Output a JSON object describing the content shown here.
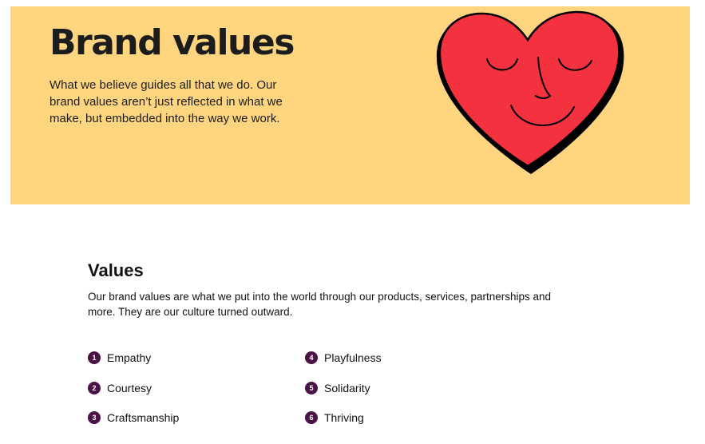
{
  "hero": {
    "title": "Brand values",
    "description": "What we believe guides all that we do. Our brand values aren’t just reflected in what we make, but embedded into the way we work.",
    "background_color": "#FFD580",
    "illustration": "smiling-heart-illustration",
    "heart_color": "#F4323F"
  },
  "values_section": {
    "title": "Values",
    "description": "Our brand values are what we put into the world through our products, services, partnerships and more. They are our culture turned outward.",
    "badge_color": "#4A1245",
    "items": [
      {
        "number": "1",
        "label": "Empathy"
      },
      {
        "number": "2",
        "label": "Courtesy"
      },
      {
        "number": "3",
        "label": "Craftsmanship"
      },
      {
        "number": "4",
        "label": "Playfulness"
      },
      {
        "number": "5",
        "label": "Solidarity"
      },
      {
        "number": "6",
        "label": "Thriving"
      }
    ]
  }
}
